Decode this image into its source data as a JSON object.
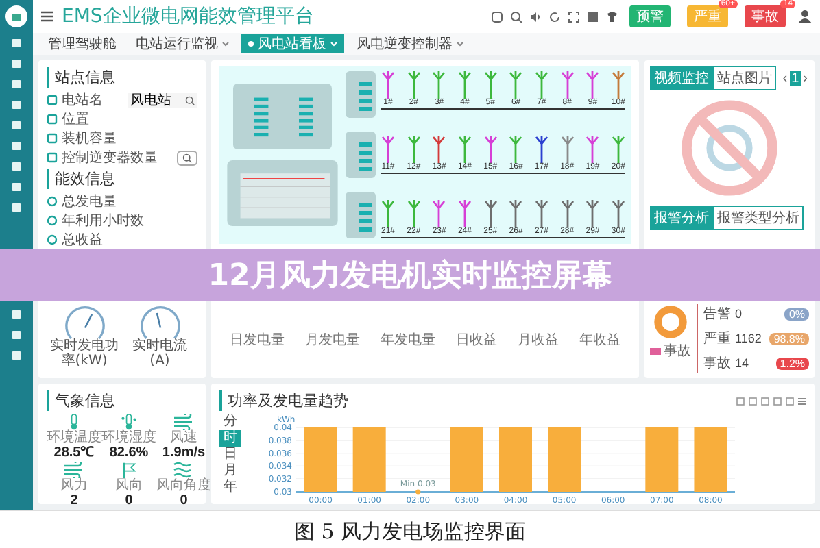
{
  "header": {
    "title": "EMS企业微电网能效管理平台",
    "buttons": [
      {
        "label": "预警",
        "color": "#22b573"
      },
      {
        "label": "严重",
        "color": "#f7b733",
        "badge": "60+"
      },
      {
        "label": "事故",
        "color": "#e8474c",
        "badge": "14"
      }
    ]
  },
  "tabs": [
    {
      "label": "管理驾驶舱",
      "selected": false,
      "dropdown": false
    },
    {
      "label": "电站运行监视",
      "selected": false,
      "dropdown": true
    },
    {
      "label": "风电站看板",
      "selected": true,
      "dropdown": true
    },
    {
      "label": "风电逆变控制器",
      "selected": false,
      "dropdown": true
    }
  ],
  "site_info": {
    "title": "站点信息",
    "rows": [
      {
        "kind": "field",
        "label": "电站名",
        "value": "风电站"
      },
      {
        "kind": "text",
        "label": "位置"
      },
      {
        "kind": "text",
        "label": "装机容量"
      },
      {
        "kind": "button",
        "label": "控制逆变器数量"
      }
    ]
  },
  "efficiency": {
    "title": "能效信息",
    "rows": [
      "总发电量",
      "年利用小时数",
      "总收益"
    ],
    "gauges": [
      {
        "label": "实时发电功率(kW)",
        "level": 0.6
      },
      {
        "label": "实时电流(A)",
        "level": 0.45
      }
    ]
  },
  "station": {
    "turbines": [
      {
        "label": "1#",
        "color": "#d63fd6"
      },
      {
        "label": "2#",
        "color": "#3db83d"
      },
      {
        "label": "3#",
        "color": "#3db83d"
      },
      {
        "label": "4#",
        "color": "#3db83d"
      },
      {
        "label": "5#",
        "color": "#3db83d"
      },
      {
        "label": "6#",
        "color": "#3db83d"
      },
      {
        "label": "7#",
        "color": "#3db83d"
      },
      {
        "label": "8#",
        "color": "#d63fd6"
      },
      {
        "label": "9#",
        "color": "#d63fd6"
      },
      {
        "label": "10#",
        "color": "#c47a3a"
      },
      {
        "label": "11#",
        "color": "#d63fd6"
      },
      {
        "label": "12#",
        "color": "#3db83d"
      },
      {
        "label": "13#",
        "color": "#d33a3a"
      },
      {
        "label": "14#",
        "color": "#3db83d"
      },
      {
        "label": "15#",
        "color": "#d63fd6"
      },
      {
        "label": "16#",
        "color": "#3db83d"
      },
      {
        "label": "17#",
        "color": "#2b3fd0"
      },
      {
        "label": "18#",
        "color": "#8a8a8a"
      },
      {
        "label": "19#",
        "color": "#d63fd6"
      },
      {
        "label": "20#",
        "color": "#3db83d"
      },
      {
        "label": "21#",
        "color": "#3db83d"
      },
      {
        "label": "22#",
        "color": "#3db83d"
      },
      {
        "label": "23#",
        "color": "#d63fd6"
      },
      {
        "label": "24#",
        "color": "#d63fd6"
      },
      {
        "label": "25#",
        "color": "#6e6e6e"
      },
      {
        "label": "26#",
        "color": "#6e6e6e"
      },
      {
        "label": "27#",
        "color": "#6e6e6e"
      },
      {
        "label": "28#",
        "color": "#6e6e6e"
      },
      {
        "label": "29#",
        "color": "#6e6e6e"
      },
      {
        "label": "30#",
        "color": "#6e6e6e"
      }
    ],
    "summaries": [
      "日发电量",
      "月发电量",
      "年发电量",
      "日收益",
      "月收益",
      "年收益"
    ]
  },
  "media": {
    "tabs": [
      {
        "label": "视频监控",
        "selected": true
      },
      {
        "label": "站点图片",
        "selected": false
      }
    ],
    "pager": {
      "prev": "‹",
      "page": "1",
      "next": "›"
    }
  },
  "alarms": {
    "tabs": [
      {
        "label": "报警分析",
        "selected": true
      },
      {
        "label": "报警类型分析",
        "selected": false
      }
    ],
    "stats": [
      {
        "label": "告警",
        "value": "0",
        "percent": "0%",
        "color": "#8aa4c8"
      },
      {
        "label": "严重",
        "value": "1162",
        "percent": "98.8%",
        "color": "#e8a66a"
      },
      {
        "label": "事故",
        "value": "14",
        "percent": "1.2%",
        "color": "#e8474c"
      }
    ],
    "legend": [
      {
        "label": "事故",
        "color": "#e0609a"
      }
    ]
  },
  "banner": {
    "text": "12月风力发电机实时监控屏幕"
  },
  "weather": {
    "title": "气象信息",
    "items": [
      {
        "kind": "thermometer",
        "label": "环境温度",
        "value": "28.5℃"
      },
      {
        "kind": "humidity",
        "label": "环境湿度",
        "value": "82.6%"
      },
      {
        "kind": "wind",
        "label": "风速",
        "value": "1.9m/s"
      },
      {
        "kind": "wind",
        "label": "风力",
        "value": "2"
      },
      {
        "kind": "flag",
        "label": "风向",
        "value": "0"
      },
      {
        "kind": "waves",
        "label": "风向角度",
        "value": "0"
      }
    ]
  },
  "trend": {
    "title": "功率及发电量趋势",
    "periods": [
      {
        "label": "分",
        "selected": false
      },
      {
        "label": "时",
        "selected": true
      },
      {
        "label": "日",
        "selected": false
      },
      {
        "label": "月",
        "selected": false
      },
      {
        "label": "年",
        "selected": false
      }
    ],
    "chart_data": {
      "type": "bar",
      "ylabel": "kWh",
      "categories": [
        "00:00",
        "01:00",
        "02:00",
        "03:00",
        "04:00",
        "05:00",
        "06:00",
        "07:00",
        "08:00"
      ],
      "values": [
        0.04,
        0.04,
        0.03,
        0.04,
        0.04,
        0.04,
        0.03,
        0.04,
        0.04
      ],
      "ylim": [
        0.03,
        0.04
      ],
      "yticks": [
        0.03,
        0.032,
        0.034,
        0.036,
        0.038,
        0.04
      ],
      "grid": true,
      "annotations": [
        "Min 0.03"
      ]
    }
  },
  "caption": "图 5 风力发电场监控界面"
}
